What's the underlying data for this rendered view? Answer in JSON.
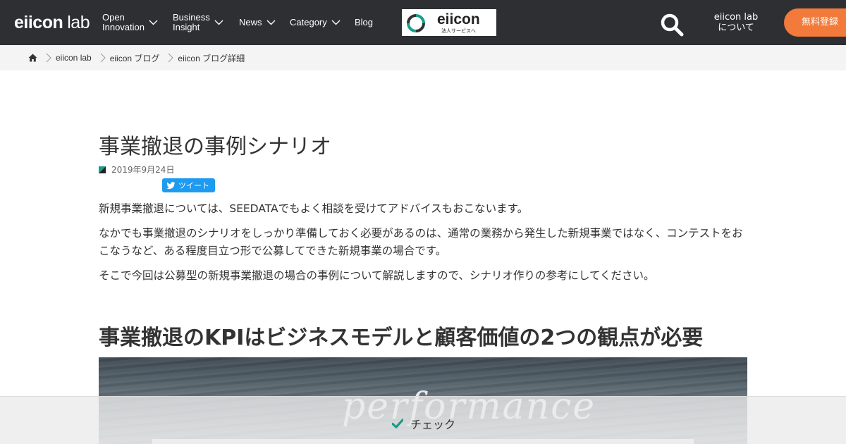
{
  "header": {
    "logo_main": "eiicon",
    "logo_sub": "lab",
    "nav": [
      {
        "line1": "Open",
        "line2": "Innovation"
      },
      {
        "line1": "Business",
        "line2": "Insight"
      },
      {
        "label": "News"
      },
      {
        "label": "Category"
      },
      {
        "label": "Blog"
      }
    ],
    "banner_brand": "eiicon",
    "banner_sub": "法人サービスへ",
    "about_line1": "eiicon lab",
    "about_line2": "について",
    "register_label": "無料登録",
    "accent": "#f27a3a",
    "background": "#2d2f33"
  },
  "breadcrumb": {
    "items": [
      "eiicon lab",
      "eiicon ブログ",
      "eiicon ブログ詳細"
    ]
  },
  "article": {
    "title": "事業撤退の事例シナリオ",
    "date": "2019年9月24日",
    "tweet_label": "ツイート",
    "paragraphs": [
      "新規事業撤退については、SEEDATAでもよく相談を受けてアドバイスもおこないます。",
      "なかでも事業撤退のシナリオをしっかり準備しておく必要があるのは、通常の業務から発生した新規事業ではなく、コンテストをおこなうなど、ある程度目立つ形で公募してできた新規事業の場合です。",
      "そこで今回は公募型の新規事業撤退の場合の事例について解説しますので、シナリオ作りの参考にしてください。"
    ],
    "heading2": "事業撤退のKPIはビジネスモデルと顧客価値の2つの観点が必要",
    "hero_word": "performance"
  },
  "overlay": {
    "check_label": "チェック",
    "check_color": "#1a9c8c"
  }
}
